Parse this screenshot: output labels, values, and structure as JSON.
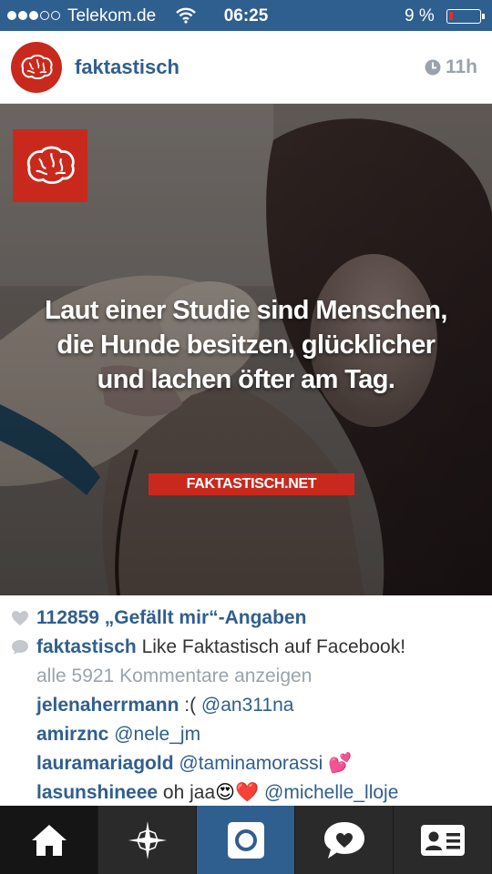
{
  "status_bar": {
    "carrier": "Telekom.de",
    "time": "06:25",
    "battery": "9 %",
    "battery_level": 0.09
  },
  "post": {
    "username": "faktastisch",
    "time_ago": "11h",
    "quote_lines": [
      "Laut einer Studie sind Menschen,",
      "die Hunde besitzen, glücklicher",
      "und lachen öfter am Tag."
    ],
    "source": "FAKTASTISCH.NET"
  },
  "caption": {
    "likes": "112859 „Gefällt mir“-Angaben",
    "author": "faktastisch",
    "text": "Like Faktastisch auf Facebook!",
    "view_all": "alle 5921 Kommentare anzeigen",
    "comments": [
      {
        "user": "jelenaherrmann",
        "text": ":( ",
        "mention": "@an311na"
      },
      {
        "user": "amirznc",
        "text": "",
        "mention": "@nele_jm"
      },
      {
        "user": "lauramariagold",
        "text": "",
        "mention": "@taminamorassi",
        "emoji": "💕"
      },
      {
        "user": "lasunshineee",
        "text": "oh jaa",
        "emoji": "😍❤️",
        "mention": "@michelle_lloje"
      }
    ]
  },
  "tabs": [
    {
      "name": "home",
      "icon": "home-icon"
    },
    {
      "name": "explore",
      "icon": "star-icon"
    },
    {
      "name": "camera",
      "icon": "camera-icon"
    },
    {
      "name": "activity",
      "icon": "heart-bubble-icon"
    },
    {
      "name": "profile",
      "icon": "profile-card-icon"
    }
  ],
  "colors": {
    "brand_blue": "#2f5f8e",
    "brand_red": "#c9291c"
  }
}
